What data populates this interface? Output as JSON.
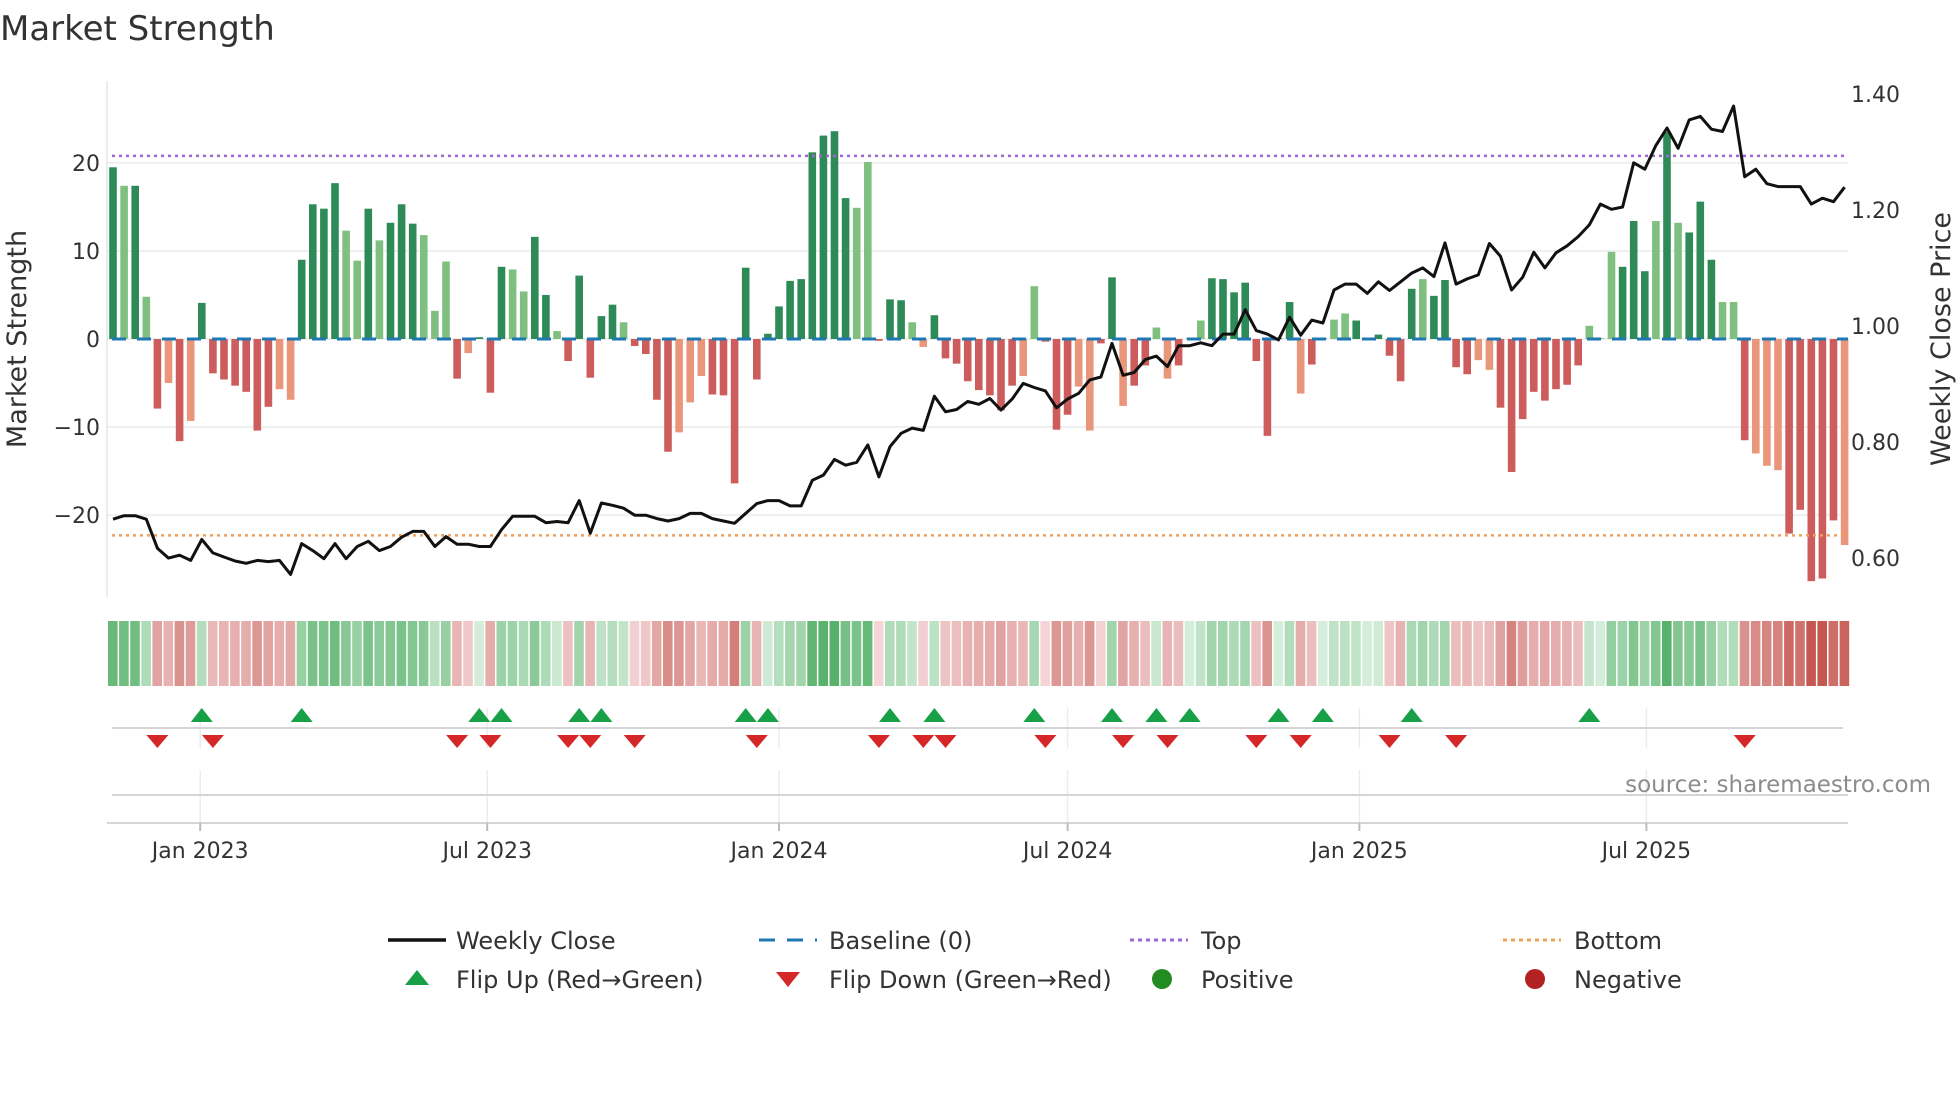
{
  "chart_data": {
    "type": "bar",
    "title": "Market Strength",
    "ylabel": "Market Strength",
    "y2label": "Weekly Close Price",
    "ylim": [
      -29.3,
      29.3
    ],
    "y2lim": [
      0.533,
      1.422
    ],
    "start_date": "2022-11-07",
    "interval_days": 7,
    "grid": true,
    "yticks": [
      {
        "v": 20,
        "label": "20"
      },
      {
        "v": 10,
        "label": "10"
      },
      {
        "v": 0,
        "label": "0"
      },
      {
        "v": -10,
        "label": "−10"
      },
      {
        "v": -20,
        "label": "−20"
      }
    ],
    "y2ticks": [
      {
        "v": 1.4,
        "label": "1.40"
      },
      {
        "v": 1.2,
        "label": "1.20"
      },
      {
        "v": 1.0,
        "label": "1.00"
      },
      {
        "v": 0.8,
        "label": "0.80"
      },
      {
        "v": 0.6,
        "label": "0.60"
      }
    ],
    "xticks": [
      {
        "date": "2023-01-01",
        "label": "Jan 2023"
      },
      {
        "date": "2023-07-01",
        "label": "Jul 2023"
      },
      {
        "date": "2024-01-01",
        "label": "Jan 2024"
      },
      {
        "date": "2024-07-01",
        "label": "Jul 2024"
      },
      {
        "date": "2025-01-01",
        "label": "Jan 2025"
      },
      {
        "date": "2025-07-01",
        "label": "Jul 2025"
      }
    ],
    "top_level": 20.8,
    "bottom_level": -22.3,
    "baseline": 0,
    "strength": [
      19.5,
      17.4,
      17.4,
      4.8,
      -7.9,
      -5.0,
      -11.6,
      -9.3,
      4.1,
      -3.9,
      -4.6,
      -5.3,
      -6.0,
      -10.4,
      -7.7,
      -5.7,
      -6.9,
      9.0,
      15.3,
      14.8,
      17.7,
      12.3,
      8.9,
      14.8,
      11.2,
      13.2,
      15.3,
      13.1,
      11.8,
      3.2,
      8.8,
      -4.5,
      -1.6,
      0.2,
      -6.1,
      8.2,
      7.9,
      5.4,
      11.6,
      5.0,
      0.9,
      -2.5,
      7.2,
      -4.4,
      2.6,
      3.9,
      1.9,
      -0.8,
      -1.7,
      -6.9,
      -12.8,
      -10.6,
      -7.2,
      -4.2,
      -6.3,
      -6.4,
      -16.4,
      8.1,
      -4.6,
      0.6,
      3.7,
      6.6,
      6.8,
      21.2,
      23.1,
      23.6,
      16.0,
      14.9,
      20.1,
      -0.2,
      4.5,
      4.4,
      1.9,
      -0.9,
      2.7,
      -2.2,
      -2.8,
      -4.8,
      -5.8,
      -6.4,
      -8.1,
      -5.3,
      -4.2,
      6.0,
      -0.3,
      -10.3,
      -8.6,
      -5.4,
      -10.4,
      -0.5,
      7.0,
      -7.6,
      -5.3,
      -3.0,
      1.3,
      -4.5,
      -3.0,
      0.1,
      2.1,
      6.9,
      6.8,
      5.3,
      6.4,
      -2.5,
      -11.0,
      0.1,
      4.2,
      -6.2,
      -2.9,
      0.1,
      2.2,
      2.9,
      2.1,
      0.15,
      0.5,
      -1.9,
      -4.8,
      5.7,
      6.8,
      4.9,
      6.7,
      -3.2,
      -4.0,
      -2.4,
      -3.5,
      -7.8,
      -15.1,
      -9.1,
      -6.0,
      -7.0,
      -5.7,
      -5.2,
      -3.0,
      1.5,
      0.1,
      9.9,
      8.2,
      13.4,
      7.7,
      13.4,
      23.5,
      13.2,
      12.1,
      15.6,
      9.0,
      4.2,
      4.2,
      -11.5,
      -13.0,
      -14.4,
      -14.9,
      -22.1,
      -19.4,
      -27.5,
      -27.2,
      -20.6,
      -23.4
    ],
    "tone": "dldldldldddddddllddddlldldddllldldddllddldddddlddddllldddddddddddddlldddllddddddddlldddllddlddlldllddddddddlddllddddddlddddllddddddddllldddldldddlldllldddddldlld",
    "weekly_close": [
      0.667,
      0.673,
      0.673,
      0.667,
      0.617,
      0.6,
      0.605,
      0.596,
      0.632,
      0.609,
      0.602,
      0.595,
      0.591,
      0.596,
      0.594,
      0.596,
      0.572,
      0.625,
      0.613,
      0.599,
      0.625,
      0.599,
      0.62,
      0.629,
      0.613,
      0.62,
      0.636,
      0.646,
      0.646,
      0.62,
      0.637,
      0.624,
      0.624,
      0.62,
      0.62,
      0.649,
      0.672,
      0.672,
      0.672,
      0.661,
      0.663,
      0.661,
      0.699,
      0.643,
      0.695,
      0.691,
      0.686,
      0.674,
      0.674,
      0.668,
      0.664,
      0.668,
      0.677,
      0.677,
      0.668,
      0.664,
      0.66,
      0.677,
      0.694,
      0.699,
      0.699,
      0.69,
      0.69,
      0.734,
      0.743,
      0.77,
      0.76,
      0.765,
      0.795,
      0.74,
      0.792,
      0.815,
      0.824,
      0.82,
      0.879,
      0.852,
      0.856,
      0.87,
      0.865,
      0.875,
      0.855,
      0.874,
      0.901,
      0.894,
      0.888,
      0.859,
      0.874,
      0.884,
      0.907,
      0.912,
      0.97,
      0.915,
      0.92,
      0.942,
      0.948,
      0.93,
      0.966,
      0.966,
      0.971,
      0.966,
      0.986,
      0.986,
      1.028,
      0.992,
      0.986,
      0.976,
      1.015,
      0.984,
      1.01,
      1.005,
      1.062,
      1.072,
      1.072,
      1.056,
      1.076,
      1.061,
      1.076,
      1.091,
      1.1,
      1.085,
      1.143,
      1.072,
      1.081,
      1.088,
      1.142,
      1.12,
      1.062,
      1.084,
      1.127,
      1.1,
      1.126,
      1.138,
      1.154,
      1.174,
      1.21,
      1.201,
      1.205,
      1.281,
      1.27,
      1.311,
      1.341,
      1.306,
      1.355,
      1.361,
      1.339,
      1.335,
      1.379,
      1.257,
      1.27,
      1.245,
      1.24,
      1.24,
      1.24,
      1.21,
      1.22,
      1.214,
      1.239
    ],
    "flip_up_weeks": [
      9,
      18,
      34,
      36,
      43,
      45,
      58,
      60,
      71,
      75,
      84,
      91,
      95,
      98,
      106,
      110,
      118,
      134
    ],
    "flip_down_weeks": [
      5,
      10,
      32,
      35,
      42,
      44,
      48,
      59,
      70,
      74,
      76,
      85,
      92,
      96,
      104,
      108,
      116,
      122,
      148
    ],
    "legend": {
      "placement": "bottom",
      "items": [
        {
          "label": "Weekly Close",
          "kind": "line"
        },
        {
          "label": "Baseline (0)",
          "kind": "dash"
        },
        {
          "label": "Top",
          "kind": "dot-top"
        },
        {
          "label": "Bottom",
          "kind": "dot-bottom"
        },
        {
          "label": "Flip Up (Red→Green)",
          "kind": "tri-up"
        },
        {
          "label": "Flip Down (Green→Red)",
          "kind": "tri-down"
        },
        {
          "label": "Positive",
          "kind": "dot-pos"
        },
        {
          "label": "Negative",
          "kind": "dot-neg"
        }
      ]
    },
    "source": "source: sharemaestro.com"
  },
  "colors": {
    "pos_dark": "#2e8b57",
    "pos_light": "#7fbf7f",
    "neg_dark": "#cd5c5c",
    "neg_light": "#e9967a",
    "line": "#111111",
    "baseline": "#1f77b4",
    "top": "#a066d6",
    "bottom": "#f0a05a",
    "flip_up": "#17a046",
    "flip_down": "#d62728",
    "positive": "#228b22",
    "negative": "#b22222"
  }
}
